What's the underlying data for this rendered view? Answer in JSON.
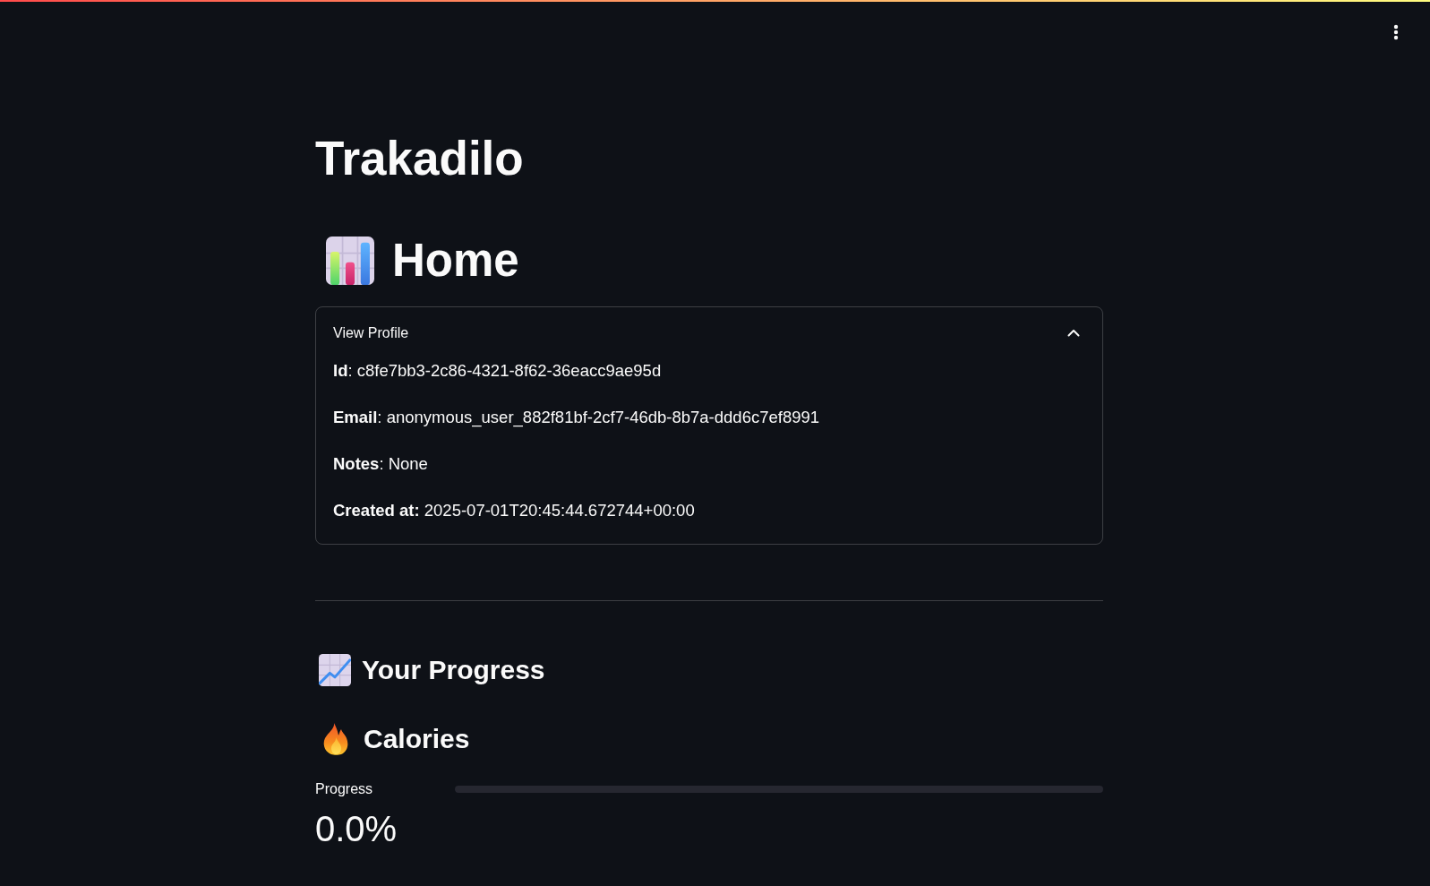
{
  "title": "Trakadilo",
  "page_heading": "Home",
  "profile_expander": {
    "label": "View Profile",
    "expanded": true,
    "fields": [
      "**Id**: c8fe7bb3-2c86-4321-8f62-36eacc9ae95d",
      "**Email**: anonymous_user_882f81bf-2cf7-46db-8b7a-ddd6c7ef8991",
      "**Notes**: None",
      "**Created at:** 2025-07-01T20:45:44.672744+00:00"
    ]
  },
  "progress_section": {
    "heading": "Your Progress",
    "metrics": [
      {
        "heading": "Calories",
        "label": "Progress",
        "level": 0,
        "reading": "0.0%"
      }
    ]
  }
}
